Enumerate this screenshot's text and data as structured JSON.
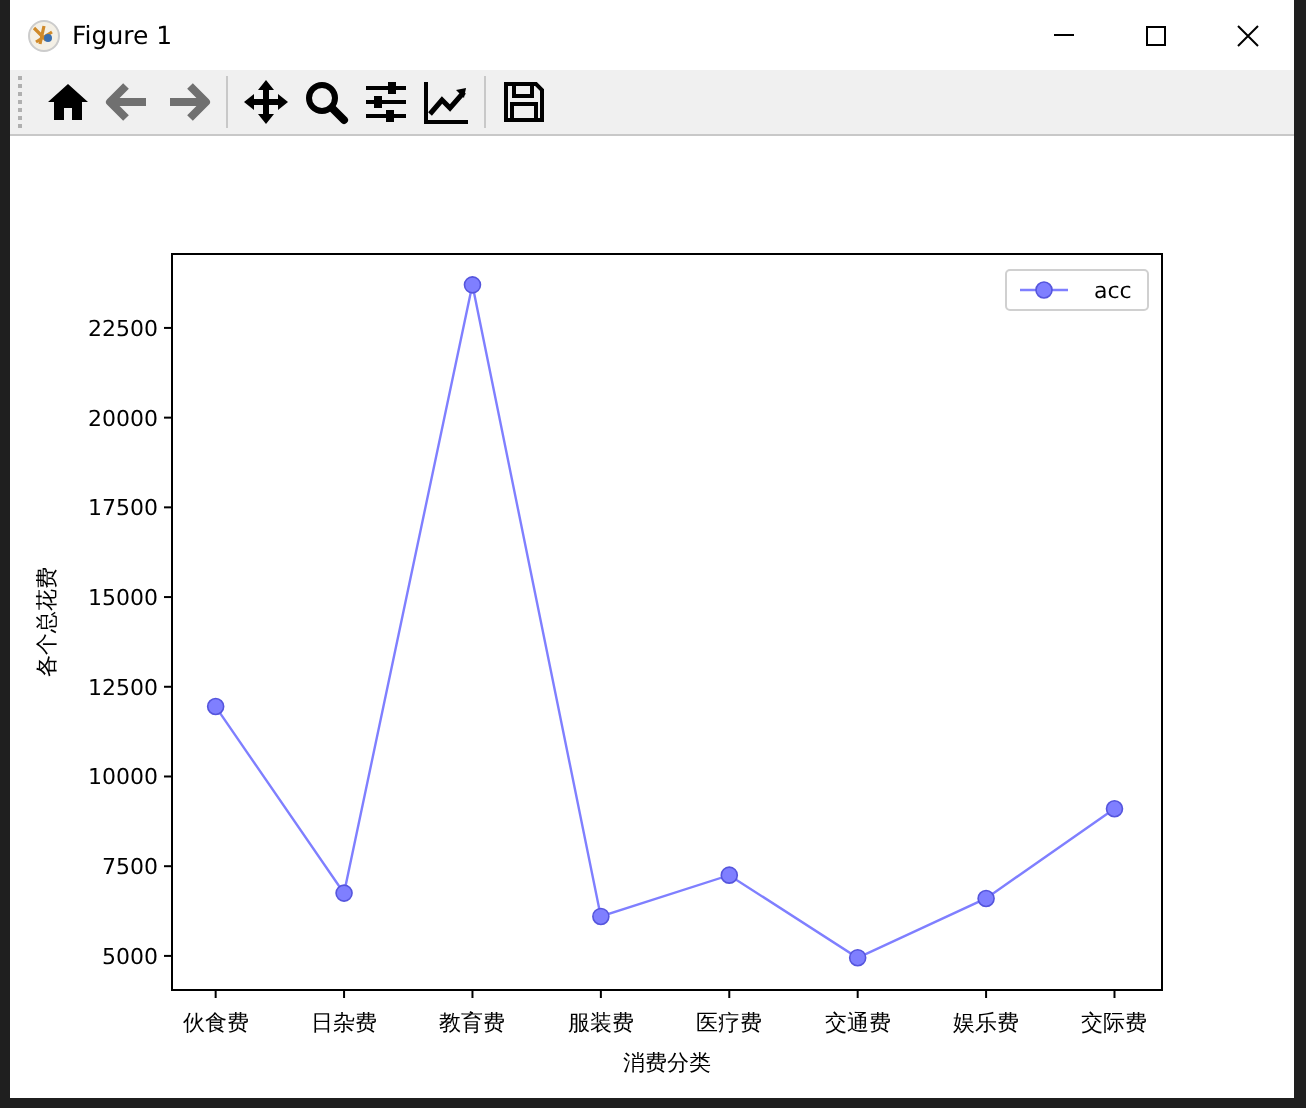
{
  "window": {
    "title": "Figure 1"
  },
  "toolbar": [
    {
      "kind": "home",
      "disabled": false
    },
    {
      "kind": "back",
      "disabled": true
    },
    {
      "kind": "forward",
      "disabled": true
    },
    {
      "kind": "separator"
    },
    {
      "kind": "pan",
      "disabled": false
    },
    {
      "kind": "zoom",
      "disabled": false
    },
    {
      "kind": "subplots",
      "disabled": false
    },
    {
      "kind": "axes",
      "disabled": false
    },
    {
      "kind": "separator"
    },
    {
      "kind": "save",
      "disabled": false
    }
  ],
  "figure": {
    "chart_data": {
      "type": "line",
      "xlabel": "消费分类",
      "ylabel": "各个总花费",
      "categories": [
        "伙食费",
        "日杂费",
        "教育费",
        "服装费",
        "医疗费",
        "交通费",
        "娱乐费",
        "交际费"
      ],
      "series": [
        {
          "name": "acc",
          "color": "#7f7fff",
          "marker": "o",
          "values": [
            11950,
            6750,
            23700,
            6100,
            7250,
            4950,
            6600,
            9100
          ]
        }
      ],
      "ylim": [
        4050,
        24560
      ],
      "yticks": [
        5000,
        7500,
        10000,
        12500,
        15000,
        17500,
        20000,
        22500
      ]
    }
  }
}
